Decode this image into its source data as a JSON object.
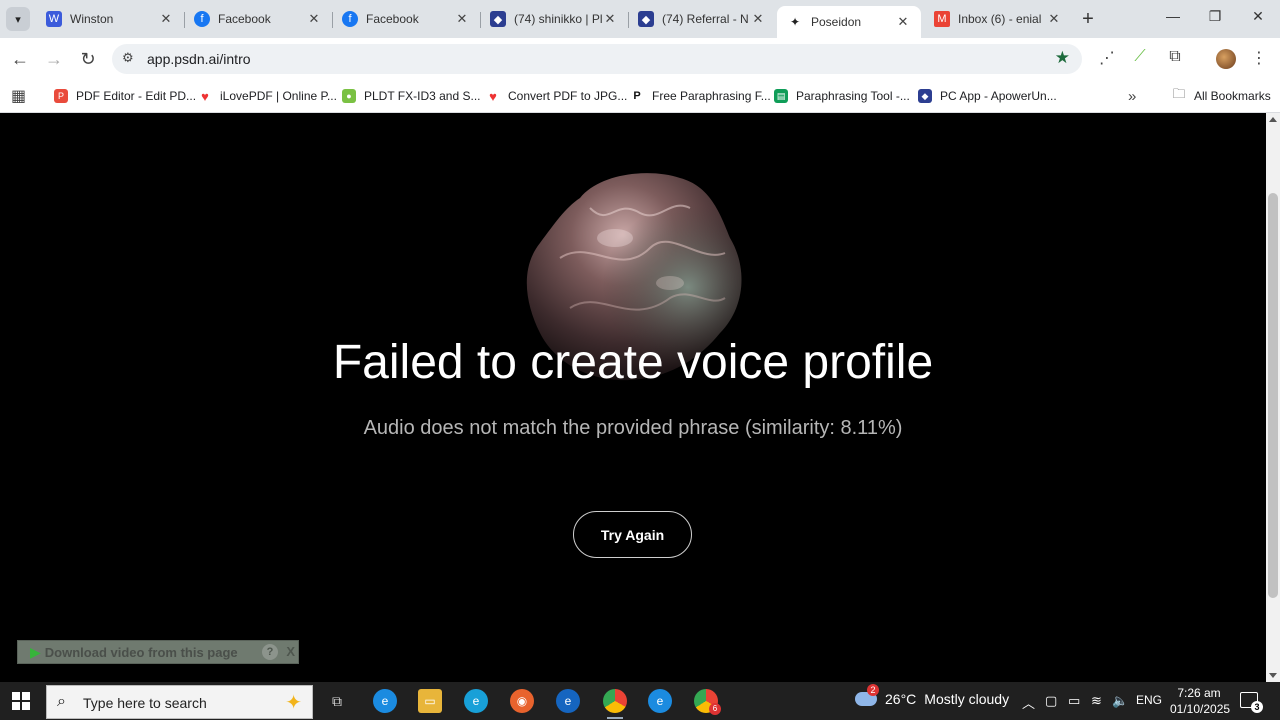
{
  "browser": {
    "tabs": [
      {
        "title": "Winston",
        "active": false
      },
      {
        "title": "Facebook",
        "active": false
      },
      {
        "title": "Facebook",
        "active": false
      },
      {
        "title": "(74) shinikko | Pl",
        "active": false
      },
      {
        "title": "(74) Referral - N",
        "active": false
      },
      {
        "title": "Poseidon",
        "active": true
      },
      {
        "title": "Inbox (6) - enial",
        "active": false
      }
    ],
    "url": "app.psdn.ai/intro",
    "bookmarks": [
      {
        "label": "PDF Editor - Edit PD..."
      },
      {
        "label": "iLovePDF | Online P..."
      },
      {
        "label": "PLDT FX-ID3 and S..."
      },
      {
        "label": "Convert PDF to JPG..."
      },
      {
        "label": "Free Paraphrasing F..."
      },
      {
        "label": "Paraphrasing Tool -..."
      },
      {
        "label": "PC App - ApowerUn..."
      }
    ],
    "all_bookmarks": "All Bookmarks"
  },
  "page": {
    "headline": "Failed to create voice profile",
    "message": "Audio does not match the provided phrase (similarity: 8.11%)",
    "button": "Try Again",
    "download_bar": {
      "label": "Download video from this page",
      "help": "?",
      "close": "X"
    }
  },
  "taskbar": {
    "search_placeholder": "Type here to search",
    "weather": {
      "temp": "26°C",
      "condition": "Mostly cloudy",
      "badge": "2"
    },
    "language": "ENG",
    "time": "7:26 am",
    "date": "01/10/2025",
    "chrome_badge": "6",
    "notification_count": "3"
  },
  "colors": {
    "page_bg": "#000000",
    "accent_star": "#1e6b3d"
  }
}
